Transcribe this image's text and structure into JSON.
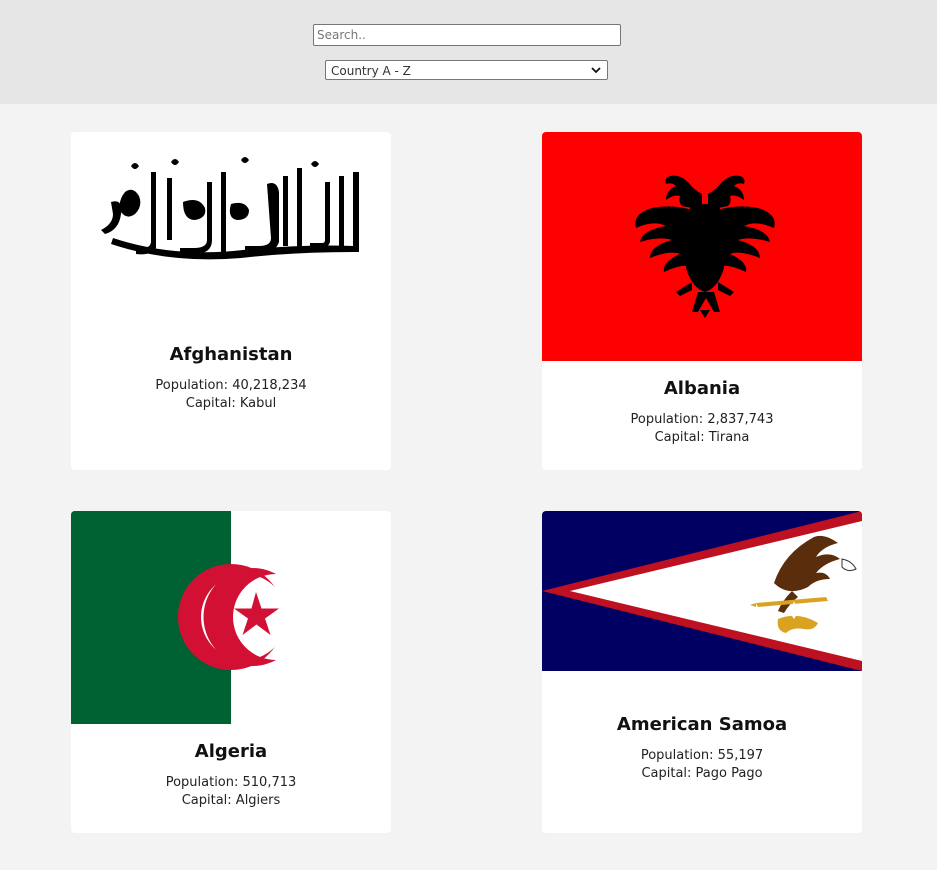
{
  "search": {
    "placeholder": "Search..",
    "value": ""
  },
  "sort": {
    "selected": "Country A - Z"
  },
  "countries": [
    {
      "name": "Afghanistan",
      "population_label": "Population: 40,218,234",
      "capital_label": "Capital: Kabul"
    },
    {
      "name": "Albania",
      "population_label": "Population: 2,837,743",
      "capital_label": "Capital: Tirana"
    },
    {
      "name": "Algeria",
      "population_label": "Population: 510,713",
      "capital_label": "Capital: Algiers"
    },
    {
      "name": "American Samoa",
      "population_label": "Population: 55,197",
      "capital_label": "Capital: Pago Pago"
    }
  ],
  "colors": {
    "page_bg": "#f3f3f3",
    "header_bg": "#e6e6e6",
    "card_bg": "#ffffff",
    "albania_red": "#ff0000",
    "algeria_green": "#006233",
    "algeria_red": "#d21034",
    "samoa_blue": "#000063",
    "samoa_red": "#bd1021"
  }
}
